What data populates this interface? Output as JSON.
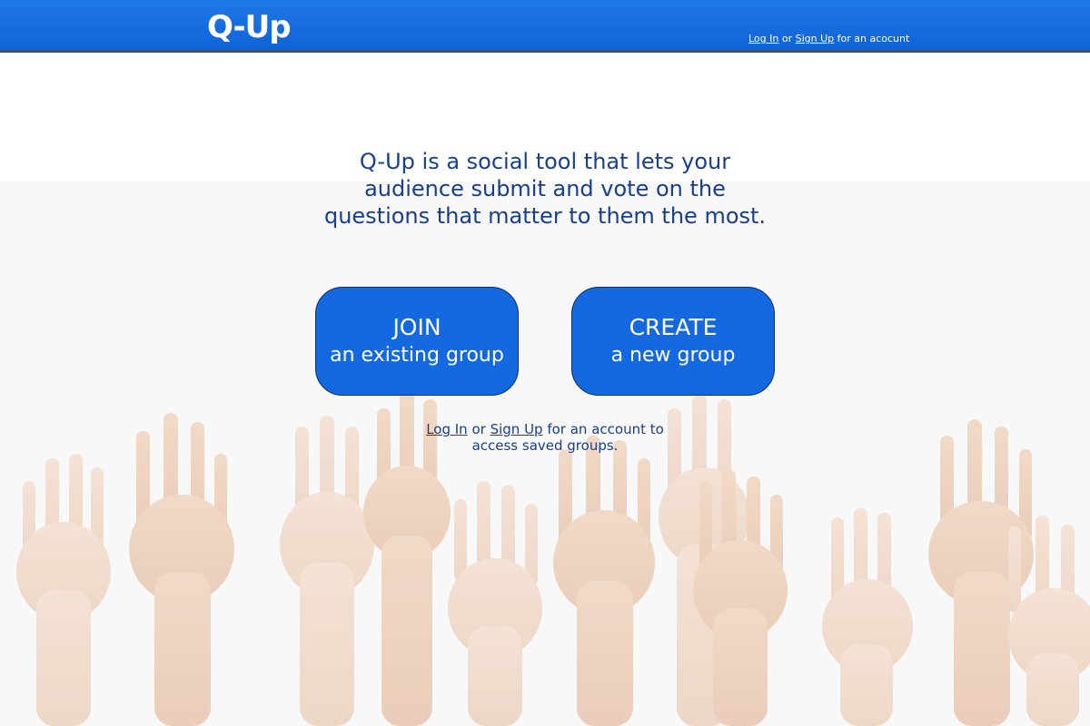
{
  "header": {
    "logo": "Q-Up",
    "login_label": "Log In",
    "or_label": " or ",
    "signup_label": "Sign Up",
    "suffix": " for an acocunt"
  },
  "tagline": [
    "Q-Up is a social tool that lets your",
    "audience submit and vote on the",
    "questions that matter to them the most."
  ],
  "join_button": {
    "title": "JOIN",
    "subtitle": "an existing group"
  },
  "create_button": {
    "title": "CREATE",
    "subtitle": "a new group"
  },
  "auth_note": {
    "login_label": "Log In",
    "or_label": " or ",
    "signup_label": "Sign Up",
    "line1_suffix": " for an account to",
    "line2": "access saved groups."
  },
  "colors": {
    "header_blue": "#1468e0",
    "text_navy": "#173f8c",
    "button_blue": "#1468e0"
  }
}
